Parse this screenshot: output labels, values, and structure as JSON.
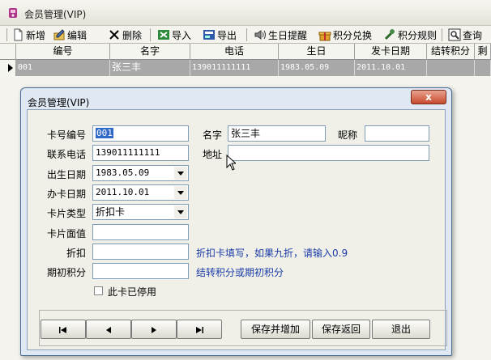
{
  "window": {
    "title": "会员管理(VIP)"
  },
  "toolbar": {
    "add": "新增",
    "edit": "编辑",
    "delete": "删除",
    "import": "导入",
    "export": "导出",
    "birthday": "生日提醒",
    "exchange": "积分兑换",
    "rules": "积分规则",
    "query": "查询"
  },
  "grid": {
    "columns": [
      "编号",
      "名字",
      "电话",
      "生日",
      "发卡日期",
      "结转积分",
      "剩"
    ],
    "rows": [
      {
        "id": "001",
        "name": "张三丰",
        "phone": "139011111111",
        "birthday": "1983.05.09",
        "issue_date": "2011.10.01",
        "carry_points": "",
        "rest": ""
      }
    ]
  },
  "dialog": {
    "title": "会员管理(VIP)",
    "close": "x",
    "labels": {
      "card_no": "卡号编号",
      "name": "名字",
      "nickname": "昵称",
      "phone": "联系电话",
      "address": "地址",
      "birth_date": "出生日期",
      "issue_date": "办卡日期",
      "card_type": "卡片类型",
      "card_face": "卡片面值",
      "discount": "折扣",
      "initial_points": "期初积分",
      "disabled": "此卡已停用"
    },
    "values": {
      "card_no": "001",
      "name": "张三丰",
      "nickname": "",
      "phone": "139011111111",
      "address": "",
      "birth_date": "1983.05.09",
      "issue_date": "2011.10.01",
      "card_type": "折扣卡",
      "card_face": "",
      "discount": "",
      "initial_points": "",
      "disabled": false
    },
    "hints": {
      "discount": "折扣卡填写，如果九折，请输入0.9",
      "initial_points": "结转积分或期初积分"
    },
    "buttons": {
      "first": "first",
      "prev": "prev",
      "next": "next",
      "last": "last",
      "save_add": "保存并增加",
      "save_return": "保存返回",
      "exit": "退出"
    }
  },
  "colors": {
    "selection": "#3169c6",
    "row_highlight": "#a8a8a8",
    "hint": "#1a3ca8",
    "close_button": "#c74a2d"
  }
}
